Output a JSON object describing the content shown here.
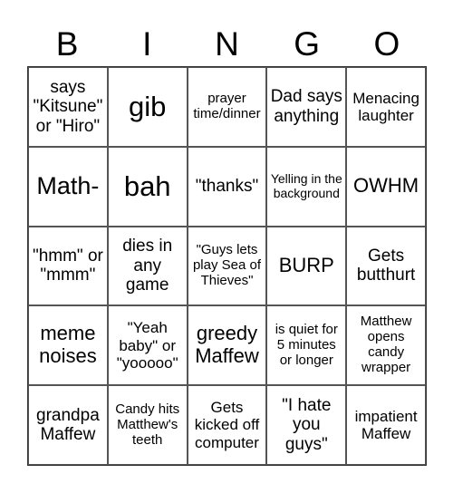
{
  "header": {
    "letters": [
      "B",
      "I",
      "N",
      "G",
      "O"
    ]
  },
  "board": {
    "rows": [
      [
        "says \"Kitsune\" or \"Hiro\"",
        "gib",
        "prayer time/dinner",
        "Dad says anything",
        "Menacing laughter"
      ],
      [
        "Math-",
        "bah",
        "\"thanks\"",
        "Yelling in the background",
        "OWHM"
      ],
      [
        "\"hmm\" or \"mmm\"",
        "dies in any game",
        "\"Guys lets play Sea of Thieves\"",
        "BURP",
        "Gets butthurt"
      ],
      [
        "meme noises",
        "\"Yeah baby\" or \"yooooo\"",
        "greedy Maffew",
        "is quiet for 5 minutes or longer",
        "Matthew opens candy wrapper"
      ],
      [
        "grandpa Maffew",
        "Candy hits Matthew's teeth",
        "Gets kicked off computer",
        "\"I hate you guys\"",
        "impatient Maffew"
      ]
    ]
  }
}
